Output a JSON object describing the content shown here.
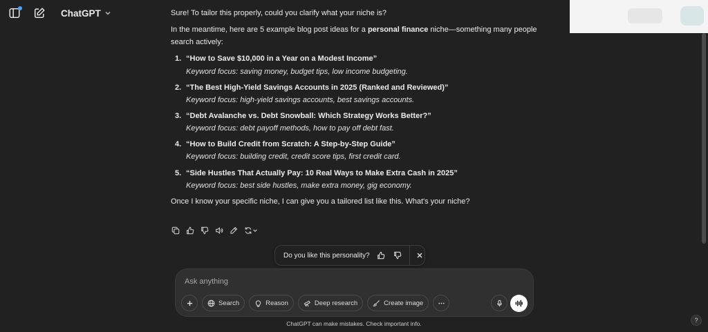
{
  "header": {
    "brand": "ChatGPT",
    "sidebar_icon": "sidebar-toggle-icon",
    "new_chat_icon": "edit-icon",
    "notification_color": "#4aa3ff"
  },
  "message": {
    "intro": "Sure! To tailor this properly, could you clarify what your niche is?",
    "lead_before": "In the meantime, here are 5 example blog post ideas for a ",
    "lead_bold": "personal finance",
    "lead_after": " niche—something many people search actively:",
    "items": [
      {
        "num": "1.",
        "title": "“How to Save $10,000 in a Year on a Modest Income”",
        "keywords": "Keyword focus: saving money, budget tips, low income budgeting."
      },
      {
        "num": "2.",
        "title": "“The Best High-Yield Savings Accounts in 2025 (Ranked and Reviewed)”",
        "keywords": "Keyword focus: high-yield savings accounts, best savings accounts."
      },
      {
        "num": "3.",
        "title": "“Debt Avalanche vs. Debt Snowball: Which Strategy Works Better?”",
        "keywords": "Keyword focus: debt payoff methods, how to pay off debt fast."
      },
      {
        "num": "4.",
        "title": "“How to Build Credit from Scratch: A Step-by-Step Guide”",
        "keywords": "Keyword focus: building credit, credit score tips, first credit card."
      },
      {
        "num": "5.",
        "title": "“Side Hustles That Actually Pay: 10 Real Ways to Make Extra Cash in 2025”",
        "keywords": "Keyword focus: best side hustles, make extra money, gig economy."
      }
    ],
    "outro": "Once I know your specific niche, I can give you a tailored list like this. What's your niche?"
  },
  "actions": [
    "copy-icon",
    "thumbs-up-icon",
    "thumbs-down-icon",
    "read-aloud-icon",
    "edit-icon",
    "regenerate-icon"
  ],
  "personality": {
    "question": "Do you like this personality?"
  },
  "composer": {
    "placeholder": "Ask anything",
    "tools": {
      "search": "Search",
      "reason": "Reason",
      "deep_research": "Deep research",
      "create_image": "Create image"
    }
  },
  "footer": {
    "disclaimer": "ChatGPT can make mistakes. Check important info.",
    "help": "?"
  }
}
